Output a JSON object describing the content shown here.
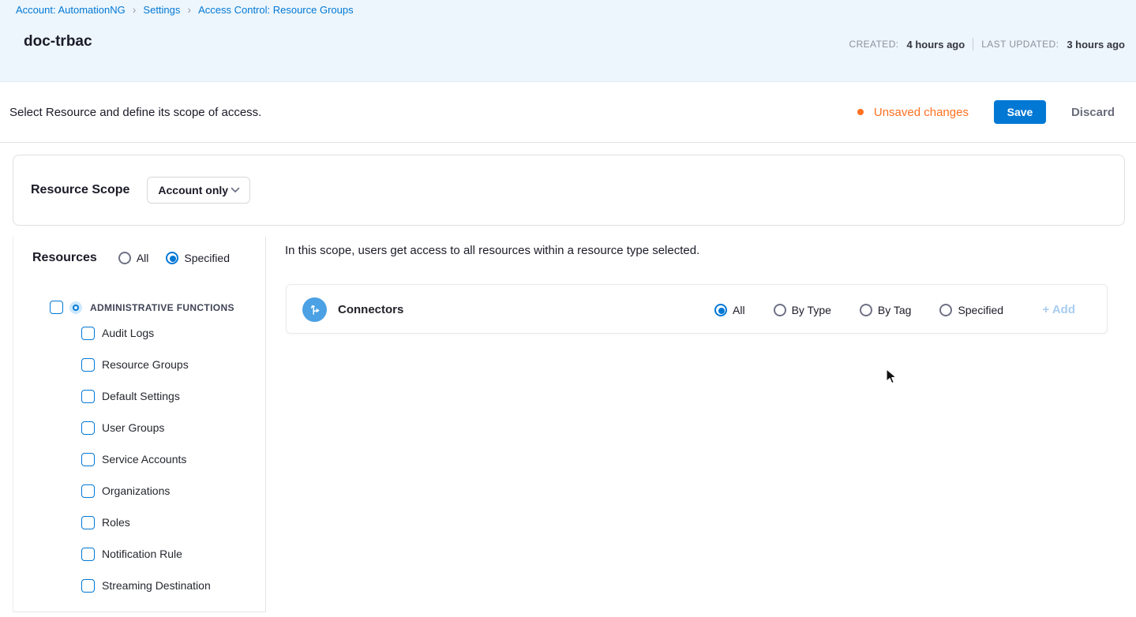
{
  "breadcrumb": {
    "separator": "›",
    "items": [
      "Account: AutomationNG",
      "Settings",
      "Access Control: Resource Groups"
    ]
  },
  "header": {
    "title": "doc-trbac",
    "created_label": "CREATED:",
    "created_value": "4 hours ago",
    "updated_label": "LAST UPDATED:",
    "updated_value": "3 hours ago"
  },
  "toolbar": {
    "description": "Select Resource and define its scope of access.",
    "unsaved_label": "Unsaved changes",
    "save_label": "Save",
    "discard_label": "Discard"
  },
  "resource_scope": {
    "title": "Resource Scope",
    "dropdown_value": "Account only"
  },
  "resources": {
    "title": "Resources",
    "options": [
      {
        "label": "All",
        "selected": false
      },
      {
        "label": "Specified",
        "selected": true
      }
    ],
    "group": {
      "label": "ADMINISTRATIVE FUNCTIONS",
      "checked": false
    },
    "items": [
      "Audit Logs",
      "Resource Groups",
      "Default Settings",
      "User Groups",
      "Service Accounts",
      "Organizations",
      "Roles",
      "Notification Rule",
      "Streaming Destination"
    ]
  },
  "main": {
    "description": "In this scope, users get access to all resources within a resource type selected.",
    "connector_row": {
      "title": "Connectors",
      "options": [
        {
          "label": "All",
          "selected": true
        },
        {
          "label": "By Type",
          "selected": false
        },
        {
          "label": "By Tag",
          "selected": false
        },
        {
          "label": "Specified",
          "selected": false
        }
      ],
      "add_label": "+ Add"
    }
  },
  "colors": {
    "primary_blue": "#0278d5",
    "header_background": "#edf6fc",
    "unsaved_orange": "#ff7020",
    "add_link_blue": "#a9cdf1",
    "connector_icon_blue": "#4ba1e4"
  }
}
